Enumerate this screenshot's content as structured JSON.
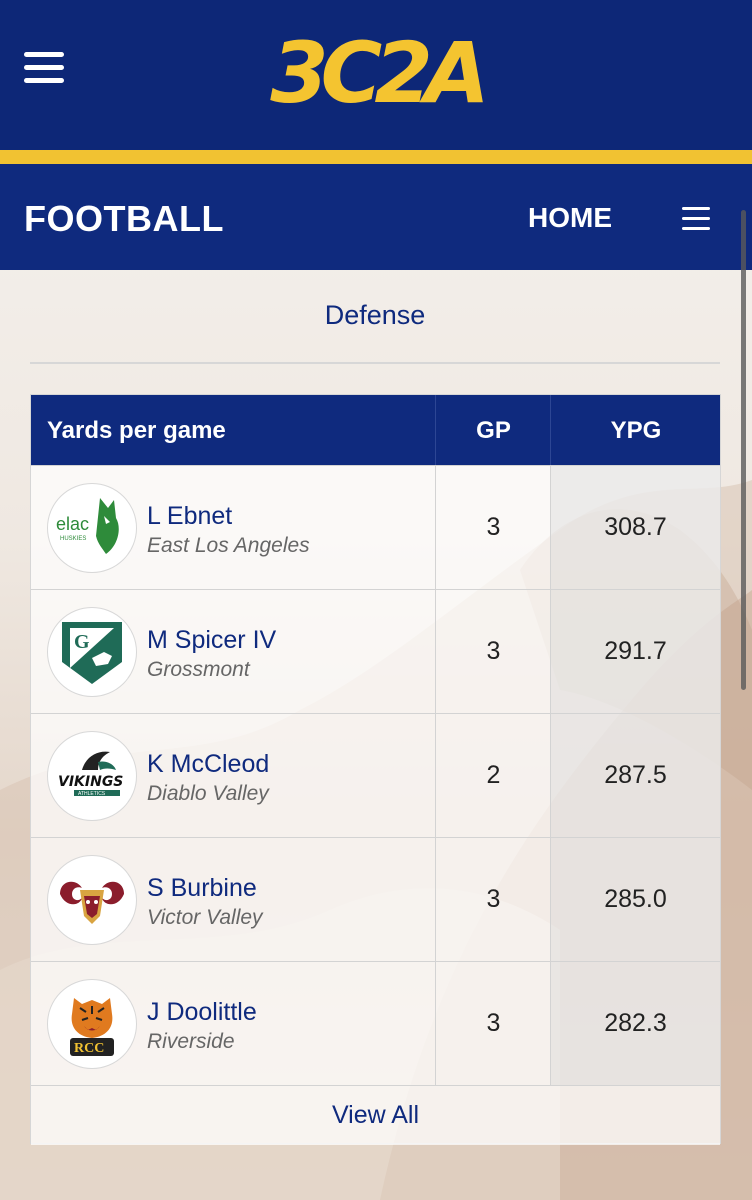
{
  "header": {
    "logo_text": "3C2A",
    "sport": "FOOTBALL",
    "home_label": "HOME",
    "icons": {
      "main_menu": "hamburger-menu-icon",
      "sub_menu": "menu-icon"
    }
  },
  "section": {
    "title": "Defense"
  },
  "table": {
    "columns": [
      "Yards per game",
      "GP",
      "YPG"
    ],
    "rows": [
      {
        "player": "L Ebnet",
        "school": "East Los Angeles",
        "logo": "elac-huskies-logo",
        "gp": "3",
        "ypg": "308.7"
      },
      {
        "player": "M Spicer IV",
        "school": "Grossmont",
        "logo": "grossmont-logo",
        "gp": "3",
        "ypg": "291.7"
      },
      {
        "player": "K McCleod",
        "school": "Diablo Valley",
        "logo": "vikings-logo",
        "gp": "2",
        "ypg": "287.5"
      },
      {
        "player": "S Burbine",
        "school": "Victor Valley",
        "logo": "rams-logo",
        "gp": "3",
        "ypg": "285.0"
      },
      {
        "player": "J Doolittle",
        "school": "Riverside",
        "logo": "rcc-tigers-logo",
        "gp": "3",
        "ypg": "282.3"
      }
    ],
    "view_all_label": "View All"
  },
  "logo_text": {
    "elac": "elac",
    "elac_sub": "HUSKIES",
    "grossmont": "G",
    "vikings": "VIKINGS",
    "vikings_sub": "ATHLETICS",
    "rcc": "RCC"
  },
  "colors": {
    "navy": "#0f2a7e",
    "gold": "#f1c232",
    "elac_green": "#2e8b3a",
    "grossmont_green": "#1f6b57",
    "rams_maroon": "#8b1d2c",
    "rams_gold": "#d9a441",
    "tiger_orange": "#e07a1f"
  }
}
